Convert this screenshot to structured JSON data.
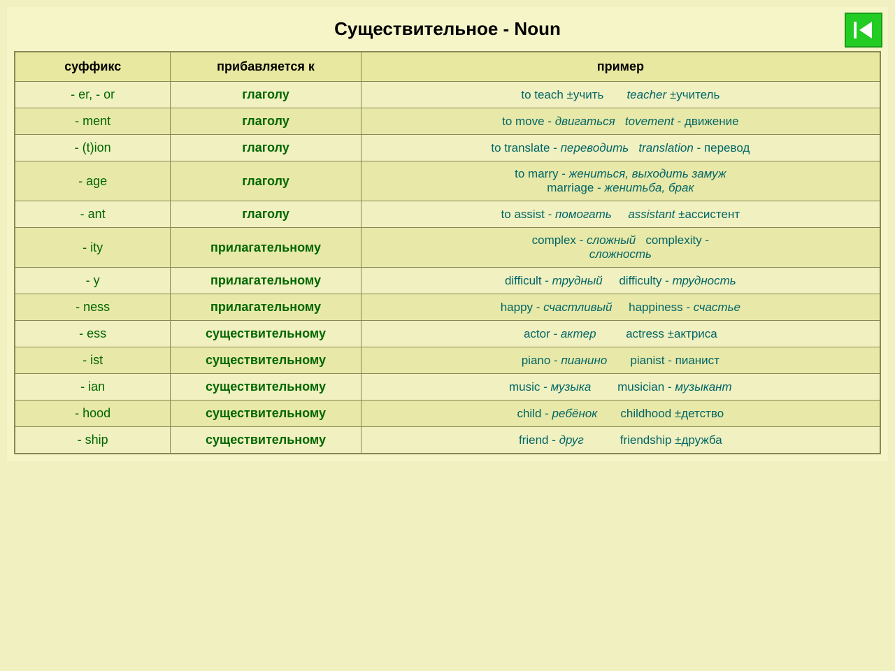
{
  "title": "Существительное - Noun",
  "nav_icon": "back-icon",
  "headers": {
    "col1": "суффикс",
    "col2": "прибавляется к",
    "col3": "пример"
  },
  "rows": [
    {
      "suffix": "- er, - or",
      "added_to": "глаголу",
      "example_html": "to teach ±учить &nbsp;&nbsp;&nbsp;&nbsp;&nbsp;&nbsp;<em>teacher</em> ±учитель"
    },
    {
      "suffix": "- ment",
      "added_to": "глаголу",
      "example_html": "to move - <em>двигаться &nbsp; tovement</em> - движение"
    },
    {
      "suffix": "- (t)ion",
      "added_to": "глаголу",
      "example_html": "to translate - <em>переводить &nbsp; translation</em> - перевод"
    },
    {
      "suffix": "- age",
      "added_to": "глаголу",
      "example_html": "to marry - <em>жениться, выходить замуж</em><br>marriage - <em>женитьба, брак</em>"
    },
    {
      "suffix": "- ant",
      "added_to": "глаголу",
      "example_html": "to assist - <em>помогать</em> &nbsp;&nbsp;&nbsp; <em>assistant</em> ±ассистент"
    },
    {
      "suffix": "- ity",
      "added_to": "прилагательному",
      "example_html": "complex - <em>сложный</em> &nbsp; complexity -<br><em>сложность</em>"
    },
    {
      "suffix": "- y",
      "added_to": "прилагательному",
      "example_html": "difficult - <em>трудный</em> &nbsp;&nbsp;&nbsp; difficulty - <em>трудность</em>"
    },
    {
      "suffix": "- ness",
      "added_to": "прилагательному",
      "example_html": "happy - <em>счастливый</em> &nbsp;&nbsp;&nbsp; happiness - <em>счастье</em>"
    },
    {
      "suffix": "- ess",
      "added_to": "существительному",
      "example_html": "actor - <em>актер</em> &nbsp;&nbsp;&nbsp;&nbsp;&nbsp;&nbsp;&nbsp; actress ±актриса"
    },
    {
      "suffix": "- ist",
      "added_to": "существительному",
      "example_html": "piano - <em>пианино</em> &nbsp;&nbsp;&nbsp;&nbsp;&nbsp; pianist - пианист"
    },
    {
      "suffix": "- ian",
      "added_to": "существительному",
      "example_html": "music - <em>музыка</em> &nbsp;&nbsp;&nbsp;&nbsp;&nbsp;&nbsp; musician - <em>музыкант</em>"
    },
    {
      "suffix": "- hood",
      "added_to": "существительному",
      "example_html": "child - <em>ребёнок</em> &nbsp;&nbsp;&nbsp;&nbsp;&nbsp; childhood ±детство"
    },
    {
      "suffix": "- ship",
      "added_to": "существительному",
      "example_html": "friend - <em>друг</em> &nbsp;&nbsp;&nbsp;&nbsp;&nbsp;&nbsp;&nbsp;&nbsp;&nbsp; friendship ±дружба"
    }
  ]
}
